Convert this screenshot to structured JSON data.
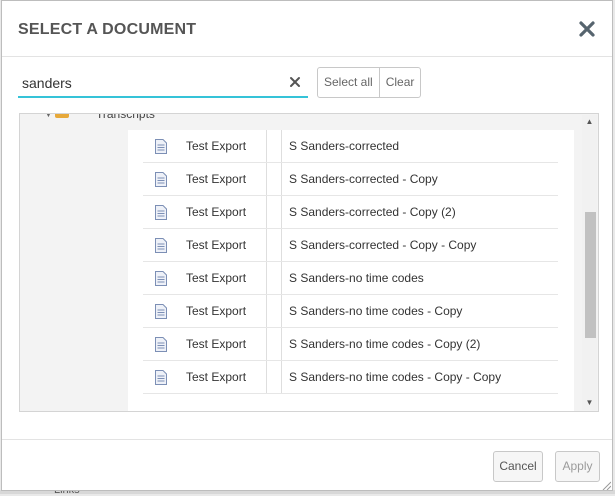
{
  "dialog": {
    "title": "SELECT A DOCUMENT",
    "close_icon": "close-icon"
  },
  "search": {
    "value": "sanders",
    "placeholder": "",
    "clear_icon": "clear-icon"
  },
  "actions": {
    "select_all": "Select all",
    "clear": "Clear"
  },
  "tree": {
    "folder_label": "Transcripts",
    "folder_icon": "folder-icon",
    "expand_icon": "caret-down-icon"
  },
  "documents": [
    {
      "folder": "Test Export",
      "name": "S Sanders-corrected",
      "icon": "document-icon"
    },
    {
      "folder": "Test Export",
      "name": "S Sanders-corrected - Copy",
      "icon": "document-icon"
    },
    {
      "folder": "Test Export",
      "name": "S Sanders-corrected - Copy (2)",
      "icon": "document-icon"
    },
    {
      "folder": "Test Export",
      "name": "S Sanders-corrected - Copy - Copy",
      "icon": "document-icon"
    },
    {
      "folder": "Test Export",
      "name": "S Sanders-no time codes",
      "icon": "document-icon"
    },
    {
      "folder": "Test Export",
      "name": "S Sanders-no time codes - Copy",
      "icon": "document-icon"
    },
    {
      "folder": "Test Export",
      "name": "S Sanders-no time codes - Copy (2)",
      "icon": "document-icon"
    },
    {
      "folder": "Test Export",
      "name": "S Sanders-no time codes - Copy - Copy",
      "icon": "document-icon"
    }
  ],
  "footer": {
    "cancel": "Cancel",
    "apply": "Apply"
  },
  "background": {
    "links_label": "Links"
  },
  "colors": {
    "search_underline": "#35c3d8",
    "folder": "#e7a93a",
    "doc_icon": "#7c8fb5"
  }
}
